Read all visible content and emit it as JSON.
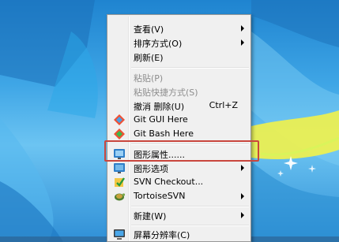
{
  "menu": {
    "items": [
      {
        "label": "查看(V)",
        "submenu": true
      },
      {
        "label": "排序方式(O)",
        "submenu": true
      },
      {
        "label": "刷新(E)"
      },
      {
        "label": "粘贴(P)",
        "disabled": true
      },
      {
        "label": "粘贴快捷方式(S)",
        "disabled": true
      },
      {
        "label": "撤消 删除(U)",
        "shortcut": "Ctrl+Z"
      },
      {
        "label": "Git GUI Here",
        "icon": "git-gui-icon"
      },
      {
        "label": "Git Bash Here",
        "icon": "git-bash-icon"
      },
      {
        "label": "图形属性......",
        "icon": "graphics-properties-icon",
        "highlighted": true
      },
      {
        "label": "图形选项",
        "icon": "graphics-options-icon",
        "submenu": true
      },
      {
        "label": "SVN Checkout...",
        "icon": "svn-checkout-icon"
      },
      {
        "label": "TortoiseSVN",
        "icon": "tortoisesvn-icon",
        "submenu": true
      },
      {
        "label": "新建(W)",
        "submenu": true
      },
      {
        "label": "屏幕分辨率(C)",
        "icon": "screen-resolution-icon"
      }
    ]
  },
  "colors": {
    "highlight_box": "#c9463d",
    "desktop_blue": "#2f8fd6"
  }
}
